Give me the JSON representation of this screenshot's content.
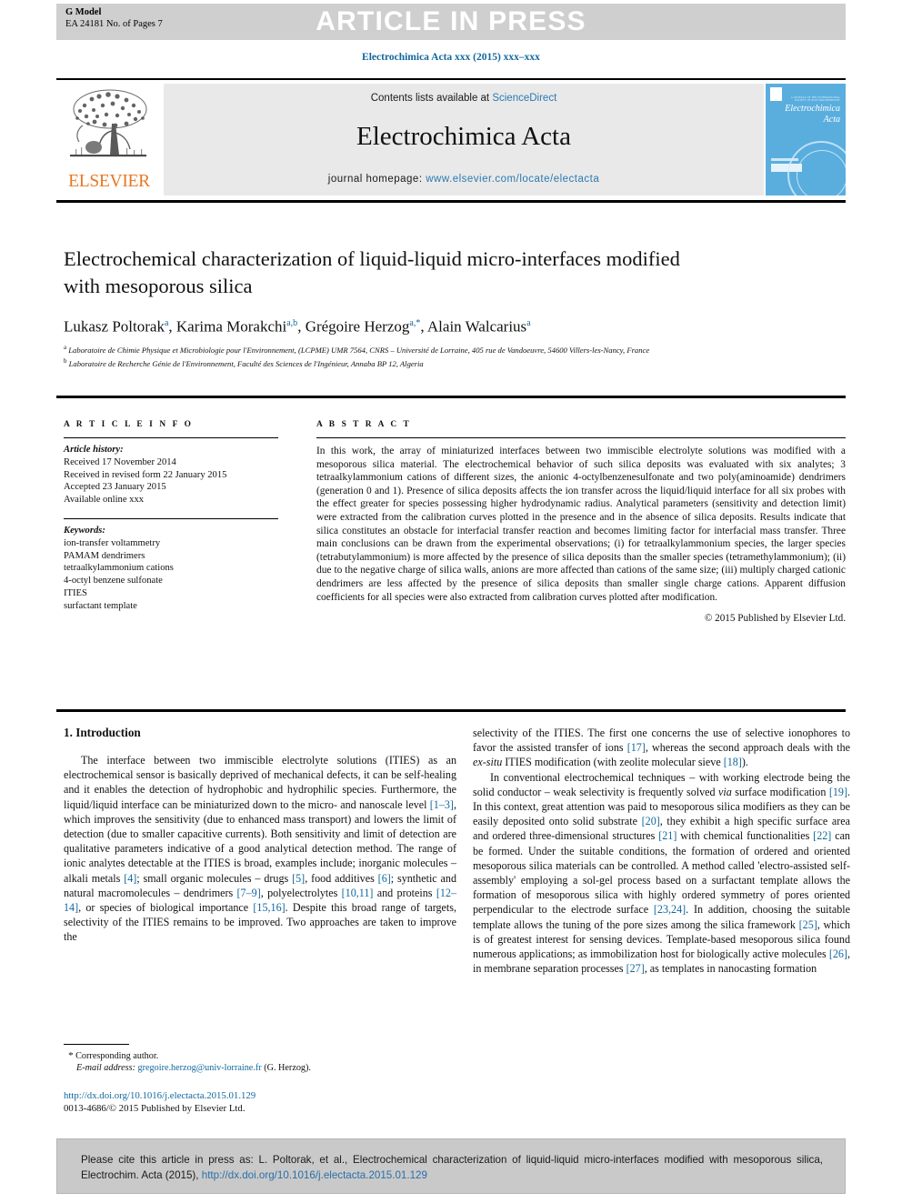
{
  "header": {
    "g_model": "G Model",
    "ea_line": "EA 24181 No. of Pages 7",
    "article_in_press": "ARTICLE IN PRESS",
    "journal_ref": "Electrochimica Acta xxx (2015) xxx–xxx"
  },
  "masthead": {
    "contents_prefix": "Contents lists available at ",
    "contents_link": "ScienceDirect",
    "journal_title": "Electrochimica Acta",
    "homepage_prefix": "journal homepage: ",
    "homepage_link": "www.elsevier.com/locate/electacta",
    "publisher_name": "ELSEVIER",
    "cover_title_line1": "Electrochimica",
    "cover_title_line2": "Acta",
    "cover_top_caption": "A JOURNAL OF THE INTERNATIONAL SOCIETY OF ELECTROCHEMISTRY"
  },
  "article": {
    "title": "Electrochemical characterization of liquid-liquid micro-interfaces modified with mesoporous silica",
    "authors_html": "Lukasz Poltorak<sup>a</sup>, Karima Morakchi<sup>a,b</sup>, Grégoire Herzog<sup>a,*</sup>, Alain Walcarius<sup>a</sup>",
    "affiliation_a": "Laboratoire de Chimie Physique et Microbiologie pour l'Environnement, (LCPME) UMR 7564, CNRS – Université de Lorraine, 405 rue de Vandoeuvre, 54600 Villers-les-Nancy, France",
    "affiliation_b": "Laboratoire de Recherche Génie de l'Environnement, Faculté des Sciences de l'Ingénieur, Annaba BP 12, Algeria"
  },
  "article_info": {
    "heading": "A R T I C L E   I N F O",
    "history_label": "Article history:",
    "history": [
      "Received 17 November 2014",
      "Received in revised form 22 January 2015",
      "Accepted 23 January 2015",
      "Available online xxx"
    ],
    "keywords_label": "Keywords:",
    "keywords": [
      "ion-transfer voltammetry",
      "PAMAM dendrimers",
      "tetraalkylammonium cations",
      "4-octyl benzene sulfonate",
      "ITIES",
      "surfactant template"
    ]
  },
  "abstract": {
    "heading": "A B S T R A C T",
    "text": "In this work, the array of miniaturized interfaces between two immiscible electrolyte solutions was modified with a mesoporous silica material. The electrochemical behavior of such silica deposits was evaluated with six analytes; 3 tetraalkylammonium cations of different sizes, the anionic 4-octylbenzenesulfonate and two poly(aminoamide) dendrimers (generation 0 and 1). Presence of silica deposits affects the ion transfer across the liquid/liquid interface for all six probes with the effect greater for species possessing higher hydrodynamic radius. Analytical parameters (sensitivity and detection limit) were extracted from the calibration curves plotted in the presence and in the absence of silica deposits. Results indicate that silica constitutes an obstacle for interfacial transfer reaction and becomes limiting factor for interfacial mass transfer. Three main conclusions can be drawn from the experimental observations; (i) for tetraalkylammonium species, the larger species (tetrabutylammonium) is more affected by the presence of silica deposits than the smaller species (tetramethylammonium); (ii) due to the negative charge of silica walls, anions are more affected than cations of the same size; (iii) multiply charged cationic dendrimers are less affected by the presence of silica deposits than smaller single charge cations. Apparent diffusion coefficients for all species were also extracted from calibration curves plotted after modification.",
    "copyright": "© 2015 Published by Elsevier Ltd."
  },
  "body": {
    "intro_heading": "1. Introduction",
    "left_paragraph_1_html": "The interface between two immiscible electrolyte solutions (ITIES) as an electrochemical sensor is basically deprived of mechanical defects, it can be self-healing and it enables the detection of hydrophobic and hydrophilic species. Furthermore, the liquid/liquid interface can be miniaturized down to the micro- and nanoscale level <span class=\"ref\">[1–3]</span>, which improves the sensitivity (due to enhanced mass transport) and lowers the limit of detection (due to smaller capacitive currents). Both sensitivity and limit of detection are qualitative parameters indicative of a good analytical detection method. The range of ionic analytes detectable at the ITIES is broad, examples include; inorganic molecules – alkali metals <span class=\"ref\">[4]</span>; small organic molecules – drugs <span class=\"ref\">[5]</span>, food additives <span class=\"ref\">[6]</span>; synthetic and natural macromolecules – dendrimers <span class=\"ref\">[7–9]</span>, polyelectrolytes <span class=\"ref\">[10,11]</span> and proteins <span class=\"ref\">[12–14]</span>, or species of biological importance <span class=\"ref\">[15,16]</span>. Despite this broad range of targets, selectivity of the ITIES remains to be improved. Two approaches are taken to improve the",
    "right_paragraph_1_html": "selectivity of the ITIES. The first one concerns the use of selective ionophores to favor the assisted transfer of ions <span class=\"ref\">[17]</span>, whereas the second approach deals with the <i>ex-situ</i> ITIES modification (with zeolite molecular sieve <span class=\"ref\">[18]</span>).",
    "right_paragraph_2_html": "In conventional electrochemical techniques – with working electrode being the solid conductor – weak selectivity is frequently solved <i>via</i> surface modification <span class=\"ref\">[19]</span>. In this context, great attention was paid to mesoporous silica modifiers as they can be easily deposited onto solid substrate <span class=\"ref\">[20]</span>, they exhibit a high specific surface area and ordered three-dimensional structures <span class=\"ref\">[21]</span> with chemical functionalities <span class=\"ref\">[22]</span> can be formed. Under the suitable conditions, the formation of ordered and oriented mesoporous silica materials can be controlled. A method called 'electro-assisted self-assembly' employing a sol-gel process based on a surfactant template allows the formation of mesoporous silica with highly ordered symmetry of pores oriented perpendicular to the electrode surface <span class=\"ref\">[23,24]</span>. In addition, choosing the suitable template allows the tuning of the pore sizes among the silica framework <span class=\"ref\">[25]</span>, which is of greatest interest for sensing devices. Template-based mesoporous silica found numerous applications; as immobilization host for biologically active molecules <span class=\"ref\">[26]</span>, in membrane separation processes <span class=\"ref\">[27]</span>, as templates in nanocasting formation"
  },
  "footnote": {
    "star": "*",
    "corresponding": "Corresponding author.",
    "email_label": "E-mail address:",
    "email": "gregoire.herzog@univ-lorraine.fr",
    "email_suffix": "(G. Herzog).",
    "doi": "http://dx.doi.org/10.1016/j.electacta.2015.01.129",
    "issn": "0013-4686/© 2015 Published by Elsevier Ltd."
  },
  "cite_box": {
    "text_prefix": "Please cite this article in press as: L. Poltorak, et al., Electrochemical characterization of liquid-liquid micro-interfaces modified with mesoporous silica, Electrochim. Acta (2015), ",
    "link": "http://dx.doi.org/10.1016/j.electacta.2015.01.129"
  },
  "colors": {
    "link_blue": "#12679c",
    "elsevier_orange": "#e87722",
    "cover_blue": "#5aaede",
    "banner_gray": "#cfcfcf",
    "cite_gray": "#c9c9c9"
  }
}
